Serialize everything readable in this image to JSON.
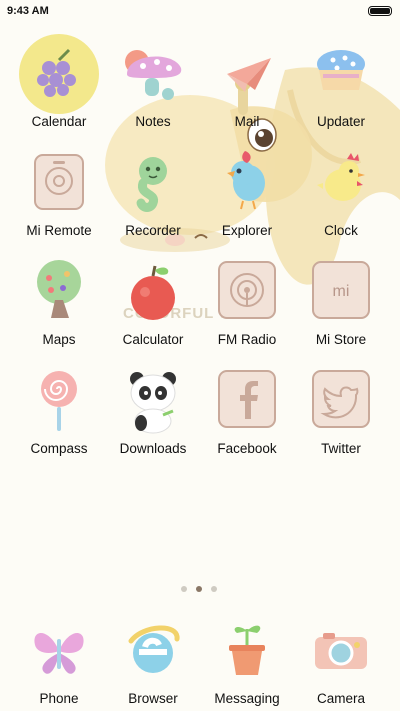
{
  "status_bar": {
    "time": "9:43 AM"
  },
  "apps": [
    {
      "label": "Calendar",
      "icon": "grapes-icon"
    },
    {
      "label": "Notes",
      "icon": "mushroom-icon"
    },
    {
      "label": "Mail",
      "icon": "paper-plane-icon"
    },
    {
      "label": "Updater",
      "icon": "cupcake-icon"
    },
    {
      "label": "Mi Remote",
      "icon": "remote-icon"
    },
    {
      "label": "Recorder",
      "icon": "green-snake-icon"
    },
    {
      "label": "Explorer",
      "icon": "blue-bird-icon"
    },
    {
      "label": "Clock",
      "icon": "chick-icon"
    },
    {
      "label": "Maps",
      "icon": "tree-icon"
    },
    {
      "label": "Calculator",
      "icon": "apple-icon"
    },
    {
      "label": "FM Radio",
      "icon": "radio-icon"
    },
    {
      "label": "Mi Store",
      "icon": "mi-store-icon"
    },
    {
      "label": "Compass",
      "icon": "lollipop-icon"
    },
    {
      "label": "Downloads",
      "icon": "panda-icon"
    },
    {
      "label": "Facebook",
      "icon": "facebook-icon"
    },
    {
      "label": "Twitter",
      "icon": "twitter-icon"
    }
  ],
  "dock": [
    {
      "label": "Phone",
      "icon": "butterfly-icon"
    },
    {
      "label": "Browser",
      "icon": "browser-e-icon"
    },
    {
      "label": "Messaging",
      "icon": "sprout-pot-icon"
    },
    {
      "label": "Camera",
      "icon": "camera-icon"
    }
  ],
  "page_indicator": {
    "count": 3,
    "active": 1
  },
  "watermark": "COLORFUL LOVE"
}
